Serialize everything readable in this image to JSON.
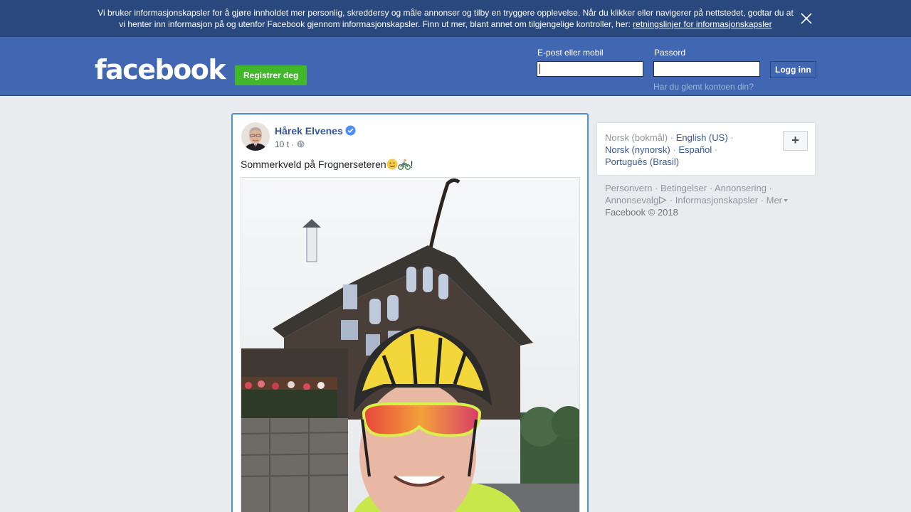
{
  "cookie_banner": {
    "text_line1": "Vi bruker informasjonskapsler for å gjøre innholdet mer personlig, skreddersy og måle annonser og tilby en tryggere opplevelse. Når du klikker eller navigerer på nettstedet, godtar du at",
    "text_line2": "vi henter inn informasjon på og utenfor Facebook gjennom informasjonskapsler. Finn ut mer, blant annet om tilgjengelige kontroller, her:",
    "link_label": "retningslinjer for informasjonskapsler",
    "close_icon": "close-icon"
  },
  "header": {
    "logo_text": "facebook",
    "signup_label": "Registrer deg",
    "email_label": "E-post eller mobil",
    "email_value": "",
    "password_label": "Passord",
    "password_value": "",
    "login_label": "Logg inn",
    "forgot_label": "Har du glemt kontoen din?"
  },
  "post": {
    "author": "Hårek Elvenes",
    "verified": true,
    "time": "10 t ·",
    "privacy_icon": "globe-icon",
    "text_before": "Sommerkveld på Frognerseteren",
    "emojis": [
      "smiling-face-emoji",
      "bicycle-emoji"
    ],
    "text_after": "!"
  },
  "languages": {
    "current": "Norsk (bokmål)",
    "links": [
      "English (US)",
      "Norsk (nynorsk)",
      "Español",
      "Português (Brasil)"
    ],
    "add_label": "+"
  },
  "footer": {
    "links": [
      "Personvern",
      "Betingelser",
      "Annonsering",
      "Annonsevalg",
      "Informasjonskapsler",
      "Mer"
    ],
    "copyright": "Facebook © 2018"
  },
  "colors": {
    "brand_blue": "#4267b2",
    "cookie_bar": "#29487d",
    "signup_green": "#42b72a",
    "link_blue": "#385898",
    "focus_border": "#4a90e2"
  }
}
